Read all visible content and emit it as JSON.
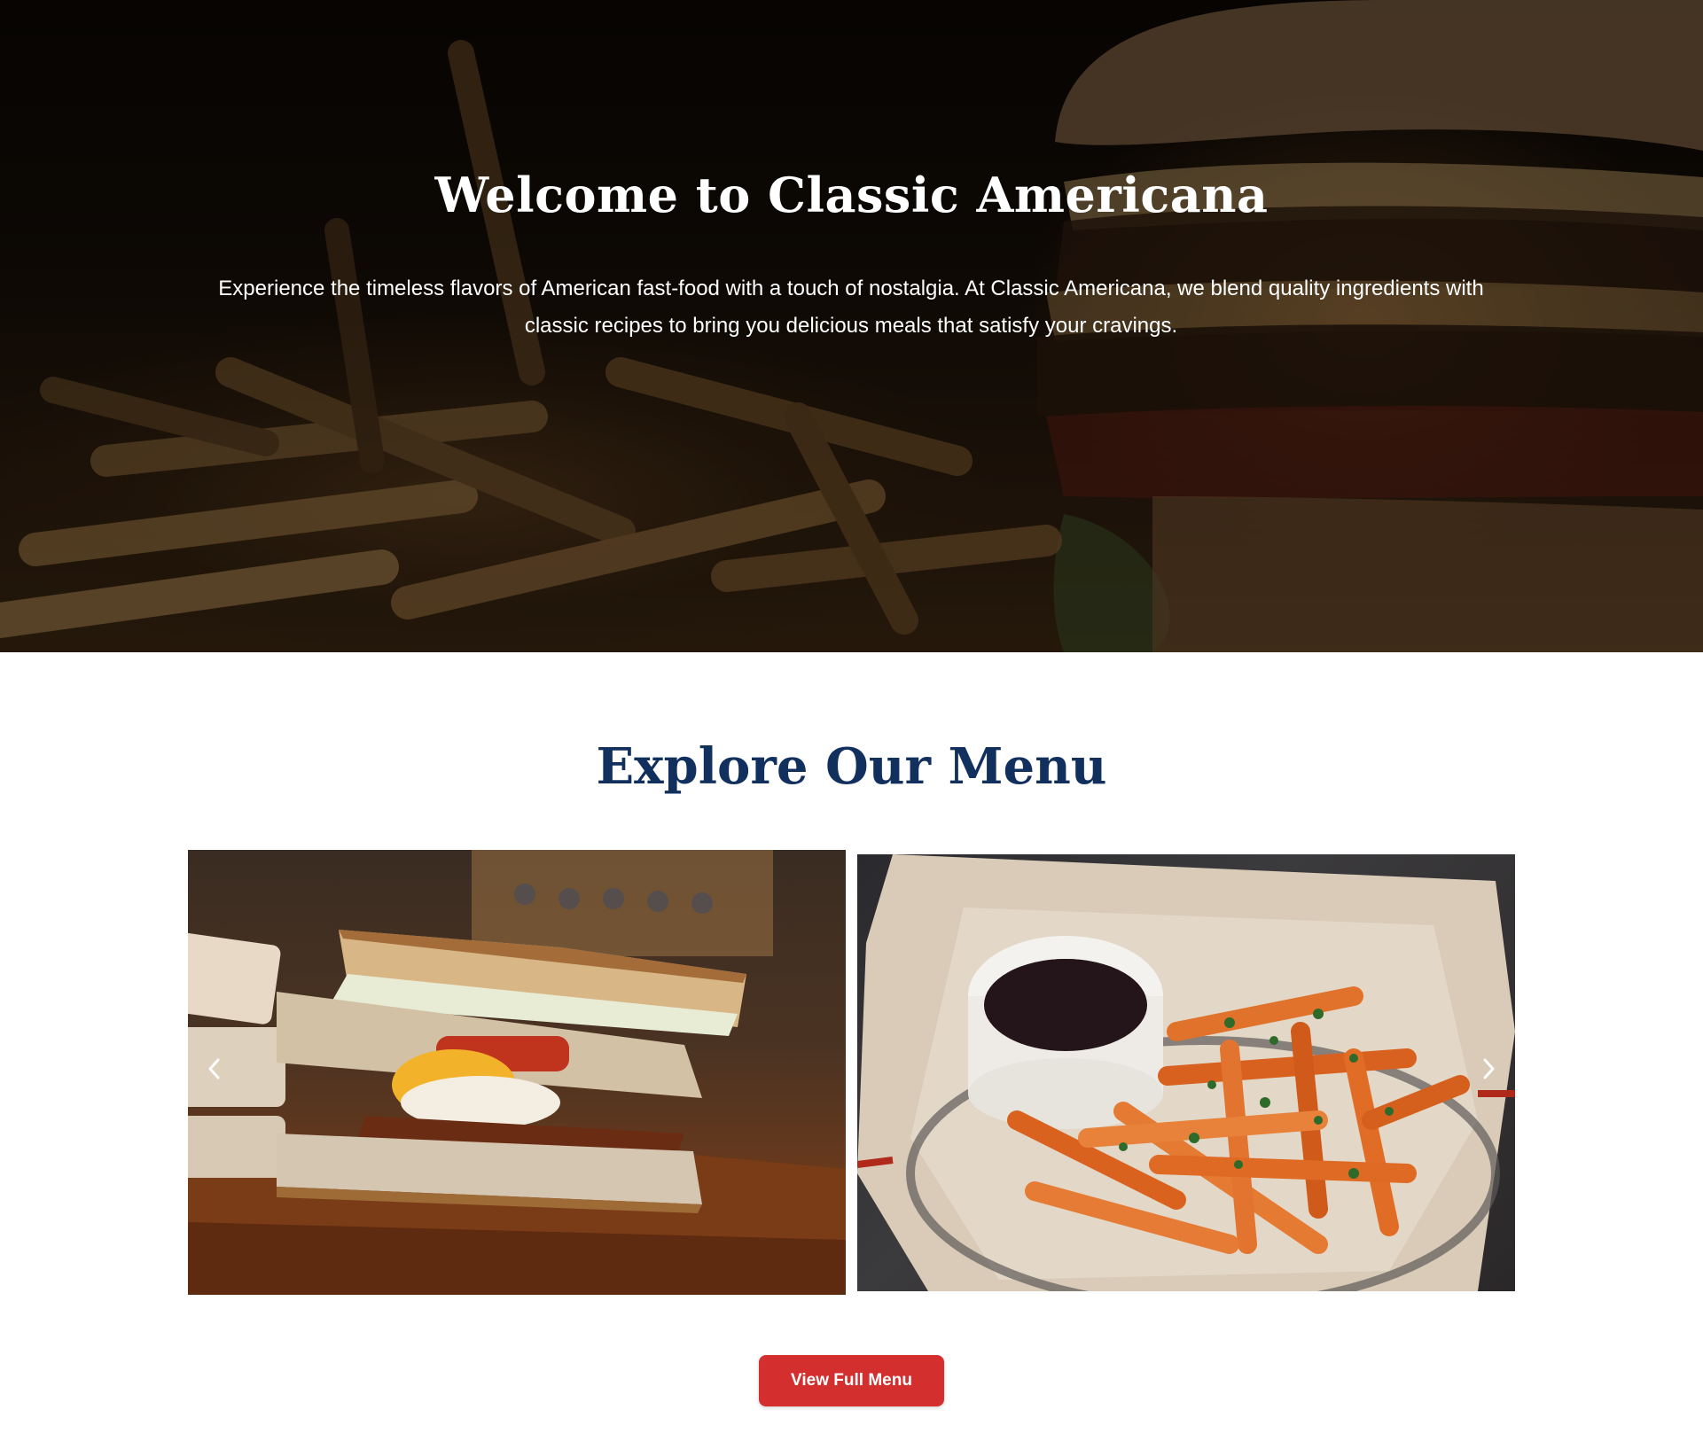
{
  "hero": {
    "title": "Welcome to Classic Americana",
    "description": "Experience the timeless flavors of American fast-food with a touch of nostalgia. At Classic Americana, we blend quality ingredients with classic recipes to bring you delicious meals that satisfy your cravings."
  },
  "menu": {
    "title": "Explore Our Menu",
    "slides": [
      "club sandwich photo",
      "sweet potato fries photo"
    ],
    "button_label": "View Full Menu"
  },
  "colors": {
    "heading_navy": "#12305e",
    "button_red": "#d32f2f",
    "hero_text": "#ffffff"
  },
  "icons": {
    "prev": "chevron-left-icon",
    "next": "chevron-right-icon"
  }
}
